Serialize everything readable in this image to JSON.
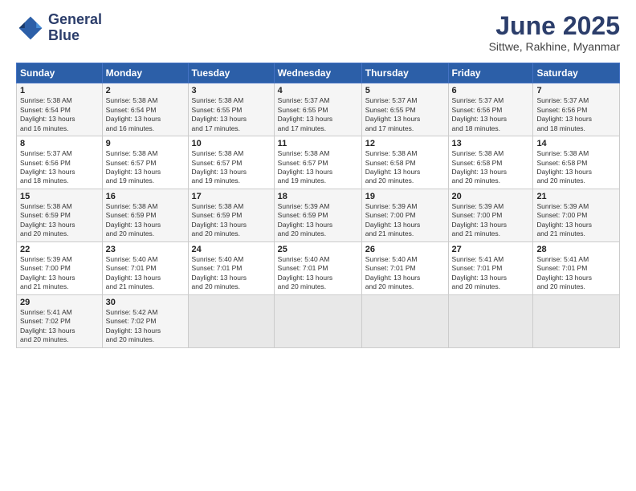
{
  "logo": {
    "line1": "General",
    "line2": "Blue"
  },
  "title": "June 2025",
  "subtitle": "Sittwe, Rakhine, Myanmar",
  "weekdays": [
    "Sunday",
    "Monday",
    "Tuesday",
    "Wednesday",
    "Thursday",
    "Friday",
    "Saturday"
  ],
  "weeks": [
    [
      {
        "day": "1",
        "info": "Sunrise: 5:38 AM\nSunset: 6:54 PM\nDaylight: 13 hours\nand 16 minutes."
      },
      {
        "day": "2",
        "info": "Sunrise: 5:38 AM\nSunset: 6:54 PM\nDaylight: 13 hours\nand 16 minutes."
      },
      {
        "day": "3",
        "info": "Sunrise: 5:38 AM\nSunset: 6:55 PM\nDaylight: 13 hours\nand 17 minutes."
      },
      {
        "day": "4",
        "info": "Sunrise: 5:37 AM\nSunset: 6:55 PM\nDaylight: 13 hours\nand 17 minutes."
      },
      {
        "day": "5",
        "info": "Sunrise: 5:37 AM\nSunset: 6:55 PM\nDaylight: 13 hours\nand 17 minutes."
      },
      {
        "day": "6",
        "info": "Sunrise: 5:37 AM\nSunset: 6:56 PM\nDaylight: 13 hours\nand 18 minutes."
      },
      {
        "day": "7",
        "info": "Sunrise: 5:37 AM\nSunset: 6:56 PM\nDaylight: 13 hours\nand 18 minutes."
      }
    ],
    [
      {
        "day": "8",
        "info": "Sunrise: 5:37 AM\nSunset: 6:56 PM\nDaylight: 13 hours\nand 18 minutes."
      },
      {
        "day": "9",
        "info": "Sunrise: 5:38 AM\nSunset: 6:57 PM\nDaylight: 13 hours\nand 19 minutes."
      },
      {
        "day": "10",
        "info": "Sunrise: 5:38 AM\nSunset: 6:57 PM\nDaylight: 13 hours\nand 19 minutes."
      },
      {
        "day": "11",
        "info": "Sunrise: 5:38 AM\nSunset: 6:57 PM\nDaylight: 13 hours\nand 19 minutes."
      },
      {
        "day": "12",
        "info": "Sunrise: 5:38 AM\nSunset: 6:58 PM\nDaylight: 13 hours\nand 20 minutes."
      },
      {
        "day": "13",
        "info": "Sunrise: 5:38 AM\nSunset: 6:58 PM\nDaylight: 13 hours\nand 20 minutes."
      },
      {
        "day": "14",
        "info": "Sunrise: 5:38 AM\nSunset: 6:58 PM\nDaylight: 13 hours\nand 20 minutes."
      }
    ],
    [
      {
        "day": "15",
        "info": "Sunrise: 5:38 AM\nSunset: 6:59 PM\nDaylight: 13 hours\nand 20 minutes."
      },
      {
        "day": "16",
        "info": "Sunrise: 5:38 AM\nSunset: 6:59 PM\nDaylight: 13 hours\nand 20 minutes."
      },
      {
        "day": "17",
        "info": "Sunrise: 5:38 AM\nSunset: 6:59 PM\nDaylight: 13 hours\nand 20 minutes."
      },
      {
        "day": "18",
        "info": "Sunrise: 5:39 AM\nSunset: 6:59 PM\nDaylight: 13 hours\nand 20 minutes."
      },
      {
        "day": "19",
        "info": "Sunrise: 5:39 AM\nSunset: 7:00 PM\nDaylight: 13 hours\nand 21 minutes."
      },
      {
        "day": "20",
        "info": "Sunrise: 5:39 AM\nSunset: 7:00 PM\nDaylight: 13 hours\nand 21 minutes."
      },
      {
        "day": "21",
        "info": "Sunrise: 5:39 AM\nSunset: 7:00 PM\nDaylight: 13 hours\nand 21 minutes."
      }
    ],
    [
      {
        "day": "22",
        "info": "Sunrise: 5:39 AM\nSunset: 7:00 PM\nDaylight: 13 hours\nand 21 minutes."
      },
      {
        "day": "23",
        "info": "Sunrise: 5:40 AM\nSunset: 7:01 PM\nDaylight: 13 hours\nand 21 minutes."
      },
      {
        "day": "24",
        "info": "Sunrise: 5:40 AM\nSunset: 7:01 PM\nDaylight: 13 hours\nand 20 minutes."
      },
      {
        "day": "25",
        "info": "Sunrise: 5:40 AM\nSunset: 7:01 PM\nDaylight: 13 hours\nand 20 minutes."
      },
      {
        "day": "26",
        "info": "Sunrise: 5:40 AM\nSunset: 7:01 PM\nDaylight: 13 hours\nand 20 minutes."
      },
      {
        "day": "27",
        "info": "Sunrise: 5:41 AM\nSunset: 7:01 PM\nDaylight: 13 hours\nand 20 minutes."
      },
      {
        "day": "28",
        "info": "Sunrise: 5:41 AM\nSunset: 7:01 PM\nDaylight: 13 hours\nand 20 minutes."
      }
    ],
    [
      {
        "day": "29",
        "info": "Sunrise: 5:41 AM\nSunset: 7:02 PM\nDaylight: 13 hours\nand 20 minutes."
      },
      {
        "day": "30",
        "info": "Sunrise: 5:42 AM\nSunset: 7:02 PM\nDaylight: 13 hours\nand 20 minutes."
      },
      {
        "day": "",
        "info": ""
      },
      {
        "day": "",
        "info": ""
      },
      {
        "day": "",
        "info": ""
      },
      {
        "day": "",
        "info": ""
      },
      {
        "day": "",
        "info": ""
      }
    ]
  ]
}
